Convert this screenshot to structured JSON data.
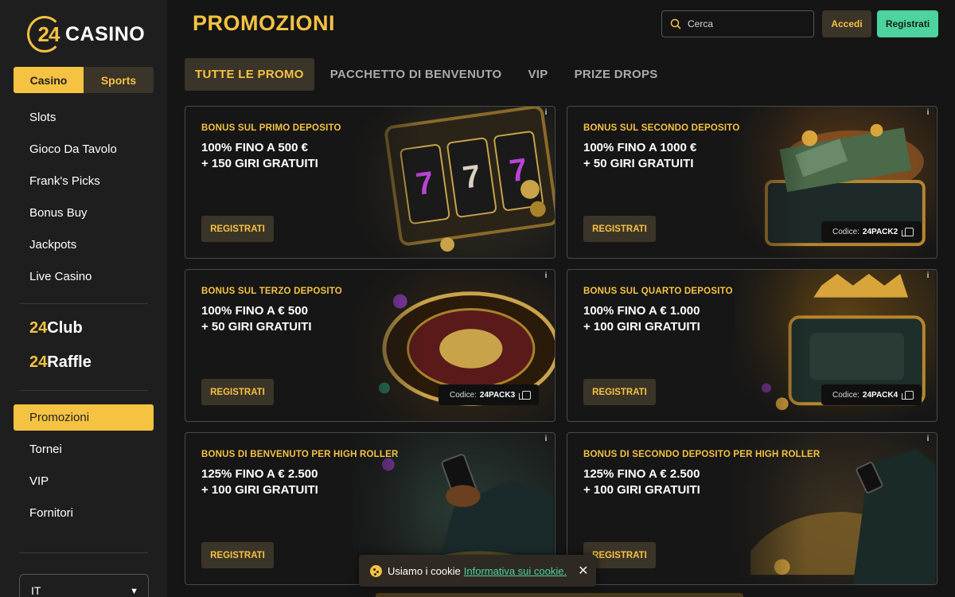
{
  "brand": {
    "number": "24",
    "name": "CASINO"
  },
  "sidebar": {
    "segment": [
      "Casino",
      "Sports"
    ],
    "items": [
      "Slots",
      "Gioco Da Tavolo",
      "Frank's Picks",
      "Bonus Buy",
      "Jackpots",
      "Live Casino"
    ],
    "club": {
      "num": "24",
      "word": "Club"
    },
    "raffle": {
      "num": "24",
      "word": "Raffle"
    },
    "active": "Promozioni",
    "items2": [
      "Tornei",
      "VIP",
      "Fornitori"
    ],
    "language": "IT"
  },
  "header": {
    "title": "PROMOZIONI",
    "search_placeholder": "Cerca",
    "login": "Accedi",
    "register": "Registrati"
  },
  "tabs": [
    "TUTTE LE PROMO",
    "PACCHETTO DI BENVENUTO",
    "VIP",
    "PRIZE DROPS"
  ],
  "cards": [
    {
      "category": "BONUS SUL PRIMO DEPOSITO",
      "line1": "100% FINO A 500 €",
      "line2": "+ 150 GIRI GRATUITI",
      "cta": "REGISTRATI",
      "code_label": "",
      "code": "",
      "art": "slot-machine"
    },
    {
      "category": "BONUS SUL SECONDO DEPOSITO",
      "line1": "100% FINO A 1000 €",
      "line2": "+ 50 GIRI GRATUITI",
      "cta": "REGISTRATI",
      "code_label": "Codice:",
      "code": "24PACK2",
      "art": "treasure-chest"
    },
    {
      "category": "BONUS SUL TERZO DEPOSITO",
      "line1": "100% FINO A € 500",
      "line2": "+ 50 GIRI GRATUITI",
      "cta": "REGISTRATI",
      "code_label": "Codice:",
      "code": "24PACK3",
      "art": "roulette"
    },
    {
      "category": "BONUS SUL QUARTO DEPOSITO",
      "line1": "100% FINO A € 1.000",
      "line2": "+ 100 GIRI GRATUITI",
      "cta": "REGISTRATI",
      "code_label": "Codice:",
      "code": "24PACK4",
      "art": "throne"
    },
    {
      "category": "BONUS DI BENVENUTO PER HIGH ROLLER",
      "line1": "125% FINO A € 2.500",
      "line2": "+ 100 GIRI GRATUITI",
      "cta": "REGISTRATI",
      "code_label": "",
      "code": "",
      "art": "high-roller-phone"
    },
    {
      "category": "BONUS DI SECONDO DEPOSITO PER HIGH ROLLER",
      "line1": "125% FINO A € 2.500",
      "line2": "+ 100 GIRI GRATUITI",
      "cta": "REGISTRATI",
      "code_label": "",
      "code": "",
      "art": "high-roller-car"
    }
  ],
  "cookie": {
    "text": "Usiamo i cookie",
    "link": "Informativa sui cookie.",
    "close": "✕"
  },
  "colors": {
    "accent": "#f5c242",
    "green": "#4dd39d",
    "bg": "#151515",
    "sidebar": "#1e1e1e"
  }
}
